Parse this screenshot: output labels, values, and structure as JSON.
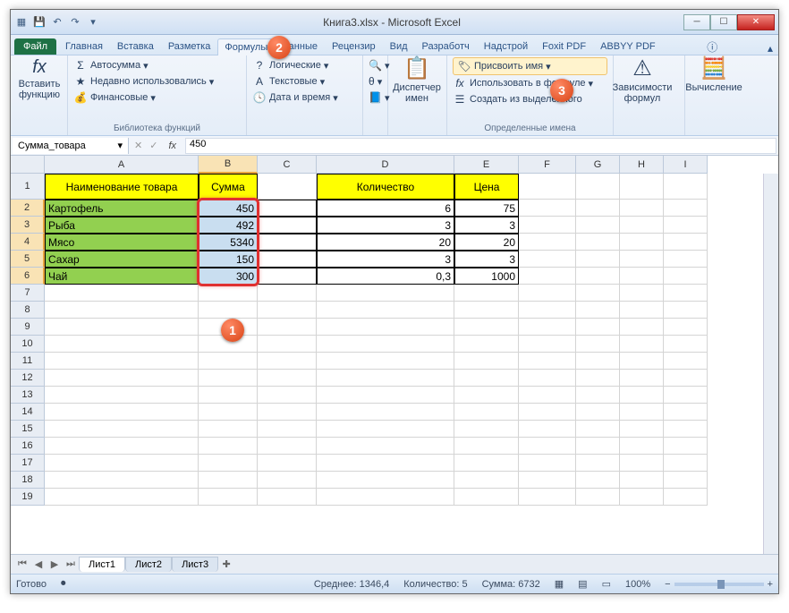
{
  "title": "Книга3.xlsx - Microsoft Excel",
  "tabs": {
    "file": "Файл",
    "items": [
      "Главная",
      "Вставка",
      "Разметка",
      "Формулы",
      "Данные",
      "Рецензир",
      "Вид",
      "Разработч",
      "Надстрой",
      "Foxit PDF",
      "ABBYY PDF"
    ],
    "active_index": 3
  },
  "ribbon": {
    "insert_fn": {
      "big_label": "Вставить\nфункцию",
      "fx": "fx"
    },
    "library": {
      "autosum": "Автосумма",
      "recent": "Недавно использовались",
      "financial": "Финансовые",
      "logical": "Логические",
      "text": "Текстовые",
      "datetime": "Дата и время",
      "title": "Библиотека функций"
    },
    "name_mgr": {
      "big_label": "Диспетчер\nимен"
    },
    "names": {
      "assign": "Присвоить имя",
      "use_in_formula": "Использовать в формуле",
      "from_selection": "Создать из выделенного",
      "title": "Определенные имена"
    },
    "deps": "Зависимости\nформул",
    "calc": "Вычисление"
  },
  "namebox": "Сумма_товара",
  "formula_value": "450",
  "columns": [
    {
      "letter": "A",
      "w": 172
    },
    {
      "letter": "B",
      "w": 66
    },
    {
      "letter": "C",
      "w": 66
    },
    {
      "letter": "D",
      "w": 154
    },
    {
      "letter": "E",
      "w": 72
    },
    {
      "letter": "F",
      "w": 64
    },
    {
      "letter": "G",
      "w": 49
    },
    {
      "letter": "H",
      "w": 49
    },
    {
      "letter": "I",
      "w": 49
    }
  ],
  "headers": {
    "A": "Наименование товара",
    "B": "Сумма",
    "D": "Количество",
    "E": "Цена"
  },
  "rows": [
    {
      "A": "Картофель",
      "B": "450",
      "D": "6",
      "E": "75"
    },
    {
      "A": "Рыба",
      "B": "492",
      "D": "3",
      "E": "3"
    },
    {
      "A": "Мясо",
      "B": "5340",
      "D": "20",
      "E": "20"
    },
    {
      "A": "Сахар",
      "B": "150",
      "D": "3",
      "E": "3"
    },
    {
      "A": "Чай",
      "B": "300",
      "D": "0,3",
      "E": "1000"
    }
  ],
  "empty_rows": 13,
  "sheets": [
    "Лист1",
    "Лист2",
    "Лист3"
  ],
  "status": {
    "ready": "Готово",
    "avg_label": "Среднее:",
    "avg": "1346,4",
    "count_label": "Количество:",
    "count": "5",
    "sum_label": "Сумма:",
    "sum": "6732",
    "zoom": "100%"
  },
  "chart_data": {
    "type": "table",
    "columns": [
      "Наименование товара",
      "Сумма",
      "Количество",
      "Цена"
    ],
    "rows": [
      [
        "Картофель",
        450,
        6,
        75
      ],
      [
        "Рыба",
        492,
        3,
        3
      ],
      [
        "Мясо",
        5340,
        20,
        20
      ],
      [
        "Сахар",
        150,
        3,
        3
      ],
      [
        "Чай",
        300,
        0.3,
        1000
      ]
    ]
  }
}
